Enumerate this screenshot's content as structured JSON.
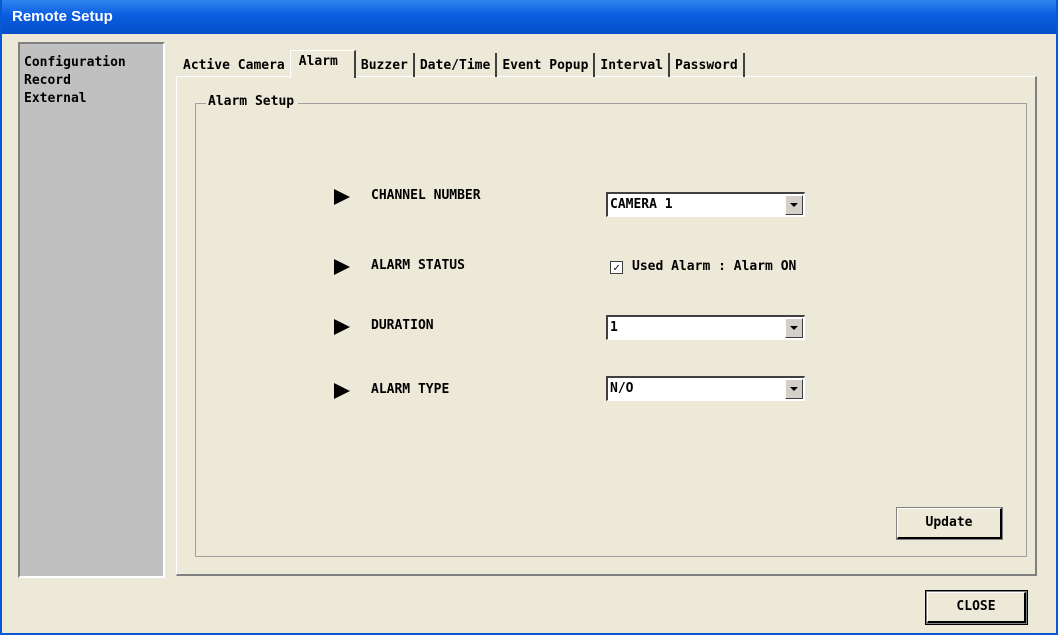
{
  "window": {
    "title": "Remote Setup"
  },
  "sidebar": {
    "items": [
      {
        "label": "Configuration"
      },
      {
        "label": "Record"
      },
      {
        "label": "External"
      }
    ]
  },
  "tabs": [
    {
      "label": "Active Camera"
    },
    {
      "label": "Alarm",
      "active": true
    },
    {
      "label": "Buzzer"
    },
    {
      "label": "Date/Time"
    },
    {
      "label": "Event Popup"
    },
    {
      "label": "Interval"
    },
    {
      "label": "Password"
    }
  ],
  "alarm_setup": {
    "group_title": "Alarm Setup",
    "channel_number": {
      "label": "CHANNEL NUMBER",
      "value": "CAMERA 1"
    },
    "alarm_status": {
      "label": "ALARM STATUS",
      "checkbox_label": "Used Alarm : Alarm ON",
      "checked": true,
      "check_mark": "✓"
    },
    "duration": {
      "label": "DURATION",
      "value": "1"
    },
    "alarm_type": {
      "label": "ALARM TYPE",
      "value": "N/O"
    }
  },
  "buttons": {
    "update": "Update",
    "close": "CLOSE"
  },
  "colors": {
    "titlebar": "#0a5de0",
    "window_bg": "#ece9d8",
    "sidebar_bg": "#c0c0c0"
  }
}
